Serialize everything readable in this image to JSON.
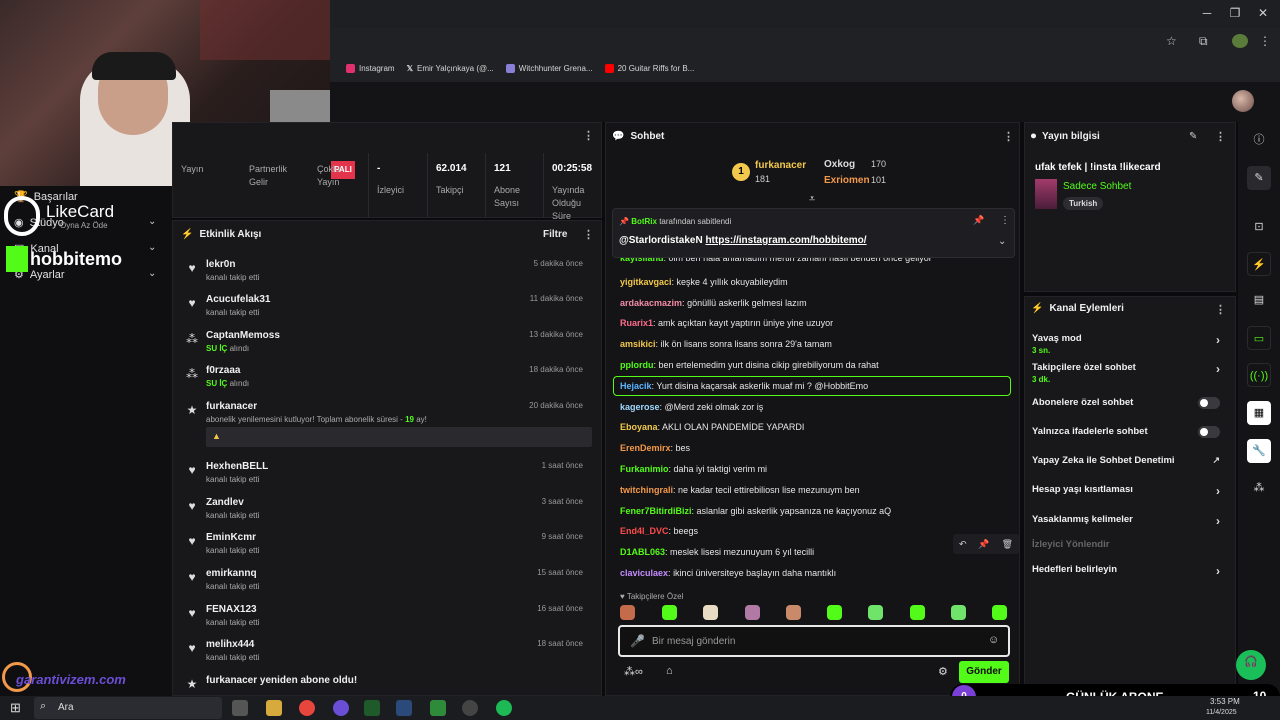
{
  "browser": {
    "bookmarks": [
      {
        "label": "Instagram",
        "icon": "instagram-icon",
        "color": "#e1306c"
      },
      {
        "label": "Emir Yalçınkaya (@...",
        "icon": "x-icon",
        "color": "#ffffff"
      },
      {
        "label": "Witchhunter Grena...",
        "icon": "shield-icon",
        "color": "#8a7fd6"
      },
      {
        "label": "20 Guitar Riffs for B...",
        "icon": "youtube-icon",
        "color": "#ff0000"
      }
    ]
  },
  "overlay": {
    "likecard": "LikeCard",
    "likecard_sub": "Oyna Az Öde",
    "brand": "hobbitemo",
    "garanti": "garantivizem.com"
  },
  "leftnav": {
    "items": [
      {
        "label": "Başarılar"
      },
      {
        "label": "Stüdyo"
      },
      {
        "label": "Kanal"
      },
      {
        "label": "Ayarlar"
      }
    ]
  },
  "stats": {
    "partial_badge": "PALI",
    "columns": [
      {
        "value": "",
        "label": "Yayın"
      },
      {
        "value": "",
        "label": "Partnerlik Gelir"
      },
      {
        "value": "",
        "label": "Çoklu Yayın"
      },
      {
        "value": "-",
        "label": "İzleyici"
      },
      {
        "value": "62.014",
        "label": "Takipçi"
      },
      {
        "value": "121",
        "label": "Abone Sayısı"
      },
      {
        "value": "00:25:58",
        "label": "Yayında Olduğu Süre"
      }
    ]
  },
  "activity": {
    "title": "Etkinlik Akışı",
    "filter": "Filtre",
    "items": [
      {
        "name": "lekr0n",
        "sub": "kanalı takip etti",
        "time": "5 dakika önce",
        "icon": "heart-icon"
      },
      {
        "name": "Acucufelak31",
        "sub": "kanalı takip etti",
        "time": "11 dakika önce",
        "icon": "heart-icon"
      },
      {
        "name": "CaptanMemoss",
        "sub_green": "SU İÇ",
        "sub": "alındı",
        "time": "13 dakika önce",
        "icon": "reward-icon"
      },
      {
        "name": "f0rzaaa",
        "sub_green": "SU İÇ",
        "sub": "alındı",
        "time": "18 dakika önce",
        "icon": "reward-icon"
      },
      {
        "name": "furkanacer",
        "sub": "abonelik yenilemesini kutluyor! Toplam abonelik süresi -",
        "sub_count": "19",
        "sub_tail": "ay!",
        "time": "20 dakika önce",
        "icon": "sub-icon"
      },
      {
        "name": "HexhenBELL",
        "sub": "kanalı takip etti",
        "time": "1 saat önce",
        "icon": "heart-icon"
      },
      {
        "name": "Zandlev",
        "sub": "kanalı takip etti",
        "time": "3 saat önce",
        "icon": "heart-icon"
      },
      {
        "name": "EminKcmr",
        "sub": "kanalı takip etti",
        "time": "9 saat önce",
        "icon": "heart-icon"
      },
      {
        "name": "emirkannq",
        "sub": "kanalı takip etti",
        "time": "15 saat önce",
        "icon": "heart-icon"
      },
      {
        "name": "FENAX123",
        "sub": "kanalı takip etti",
        "time": "16 saat önce",
        "icon": "heart-icon"
      },
      {
        "name": "melihx444",
        "sub": "kanalı takip etti",
        "time": "18 saat önce",
        "icon": "heart-icon"
      },
      {
        "name": "furkanacer yeniden abone oldu!",
        "sub": "",
        "time": "",
        "icon": "sub-icon"
      }
    ]
  },
  "chat": {
    "title": "Sohbet",
    "leaderboard": [
      {
        "rank": "1",
        "name": "furkanacer",
        "amount": "181"
      },
      {
        "name": "Oxkog",
        "amount": "170"
      },
      {
        "name": "Exriomen",
        "amount": "101"
      }
    ],
    "pinned": {
      "by_user": "BotRix",
      "by_text": "tarafından sabitlendi",
      "user": "@StarlordistakeN",
      "link": "https://instagram.com/hobbitemo/"
    },
    "messages": [
      {
        "user": "kayısıland",
        "text": "olm ben hala anlamadım mertin zamanı nasıl benden önce geliyor",
        "color": "#53fc18"
      },
      {
        "user": "yigitkavgaci",
        "text": "keşke 4 yıllık okuyabileydim",
        "color": "#f2c94c"
      },
      {
        "user": "ardakacmazim",
        "text": "gönüllü askerlik gelmesi lazım",
        "color": "#f28ca6"
      },
      {
        "user": "Ruarix1",
        "text": "amk açıktan kayıt yaptırın üniye yine uzuyor",
        "color": "#ff6b8b"
      },
      {
        "user": "amsikici",
        "text": "ilk ön lisans sonra lisans sonra 29'a tamam",
        "color": "#f2c94c"
      },
      {
        "user": "pplordu",
        "text": "ben ertelemedim yurt disina cikip girebiliyorum da rahat",
        "color": "#53fc18"
      },
      {
        "user": "Hejacik",
        "text": "Yurt disina kaçarsak askerlik muaf mi ? @HobbitEmo",
        "color": "#5ab4ff"
      },
      {
        "user": "kagerose",
        "text": "@Merd zeki olmak zor iş",
        "color": "#9fd8ff"
      },
      {
        "user": "Eboyana",
        "text": "AKLI OLAN PANDEMİDE YAPARDI",
        "color": "#f2c94c"
      },
      {
        "user": "ErenDemirx",
        "text": "bes",
        "color": "#f2994a"
      },
      {
        "user": "Furkanimio",
        "text": "daha iyi taktigi verim mi",
        "color": "#53fc18"
      },
      {
        "user": "twitchingrali",
        "text": "ne kadar tecil ettirebiliosn lise mezunuym ben",
        "color": "#f2994a"
      },
      {
        "user": "Fener7BitirdiBizi",
        "text": "aslanlar gibi askerlik yapsanıza ne kaçıyonuz aQ",
        "color": "#53fc18"
      },
      {
        "user": "End4l_DVC",
        "text": "beegs",
        "color": "#ff4b4b"
      },
      {
        "user": "D1ABL063",
        "text": "meslek lisesi mezunuyum 6 yıl tecilli",
        "color": "#53fc18"
      },
      {
        "user": "claviculaex",
        "text": "ikinci üniversiteye başlayın daha mantıklı",
        "color": "#c58cff"
      }
    ],
    "followers_only": "Takipçilere Özel",
    "input_placeholder": "Bir mesaj gönderin",
    "send": "Gönder"
  },
  "streaminfo": {
    "title": "Yayın bilgisi",
    "stream_title": "ufak tefek | !insta !likecard",
    "category": "Sadece Sohbet",
    "tag": "Turkish"
  },
  "actions": {
    "title": "Kanal Eylemleri",
    "items": [
      {
        "label": "Yavaş mod",
        "sub": "3 sn.",
        "control": "arrow"
      },
      {
        "label": "Takipçilere özel sohbet",
        "sub": "3 dk.",
        "control": "arrow"
      },
      {
        "label": "Abonelere özel sohbet",
        "sub": "",
        "control": "toggle"
      },
      {
        "label": "Yalnızca ifadelerle sohbet",
        "sub": "",
        "control": "toggle"
      },
      {
        "label": "Yapay Zeka ile Sohbet Denetimi",
        "sub": "",
        "control": "external"
      },
      {
        "label": "Hesap yaşı kısıtlaması",
        "sub": "",
        "control": "arrow"
      },
      {
        "label": "Yasaklanmış kelimeler",
        "sub": "",
        "control": "arrow"
      },
      {
        "label": "İzleyici Yönlendir",
        "sub": "",
        "control": "none",
        "disabled": true
      },
      {
        "label": "Hedefleri belirleyin",
        "sub": "",
        "control": "arrow"
      }
    ]
  },
  "goal": {
    "current": "0",
    "label": "GÜNLÜK ABONE",
    "target": "10"
  },
  "taskbar": {
    "search": "Ara",
    "time": "3:53 PM",
    "date": "11/4/2025"
  },
  "colors": {
    "accent": "#53fc18",
    "panel": "#18181b",
    "bg": "#0b0b0d"
  }
}
